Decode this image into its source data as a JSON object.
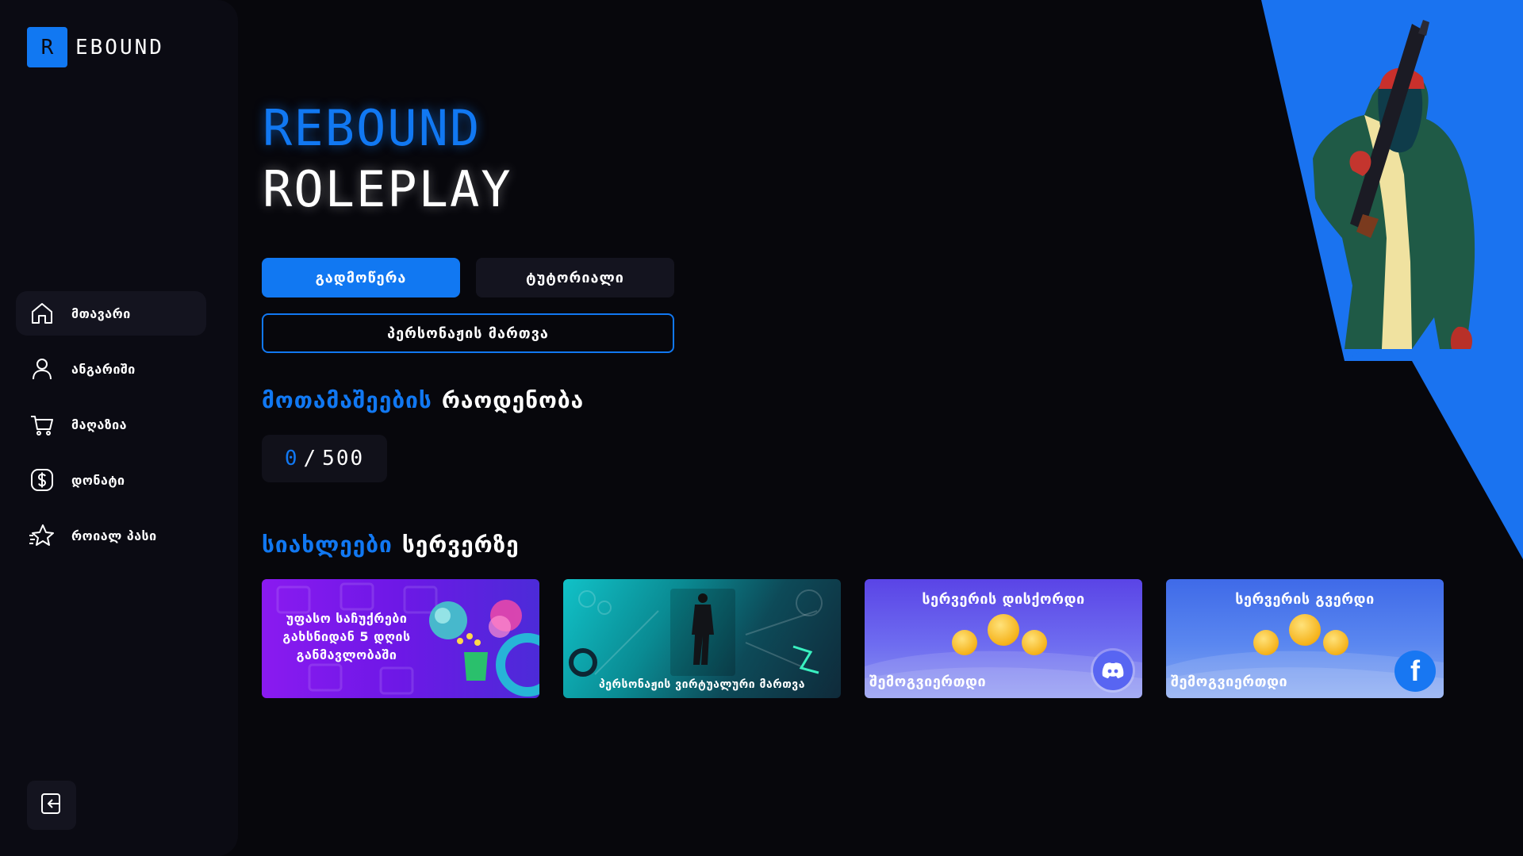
{
  "brand": {
    "logo_letter": "R",
    "logo_text": "EBOUND"
  },
  "sidebar": {
    "items": [
      {
        "label": "მთავარი",
        "icon": "home-icon",
        "active": true
      },
      {
        "label": "ანგარიში",
        "icon": "user-icon",
        "active": false
      },
      {
        "label": "მაღაზია",
        "icon": "cart-icon",
        "active": false
      },
      {
        "label": "დონატი",
        "icon": "dollar-icon",
        "active": false
      },
      {
        "label": "როიალ პასი",
        "icon": "star-icon",
        "active": false
      }
    ],
    "logout_icon": "logout-icon"
  },
  "hero": {
    "title_line1": "REBOUND",
    "title_line2": "ROLEPLAY"
  },
  "buttons": {
    "download": "გადმოწერა",
    "tutorial": "ტუტორიალი",
    "character": "პერსონაჟის მართვა"
  },
  "players": {
    "title_blue": "მოთამაშეების",
    "title_white": "რაოდენობა",
    "current": "0",
    "separator": "/",
    "max": "500"
  },
  "news": {
    "title_blue": "სიახლეები",
    "title_white": "სერვერზე",
    "cards": [
      {
        "text": "უფასო საჩუქრები გახსნიდან 5 დღის განმავლობაში"
      },
      {
        "text": "პერსონაჟის ვირტუალური მართვა"
      },
      {
        "head": "სერვერის დისქორდი",
        "foot": "შემოგვიერთდი"
      },
      {
        "head": "სერვერის გვერდი",
        "foot": "შემოგვიერთდი"
      }
    ]
  },
  "colors": {
    "accent": "#1178f2",
    "background": "#07070c",
    "sidebar": "#0b0b13"
  }
}
